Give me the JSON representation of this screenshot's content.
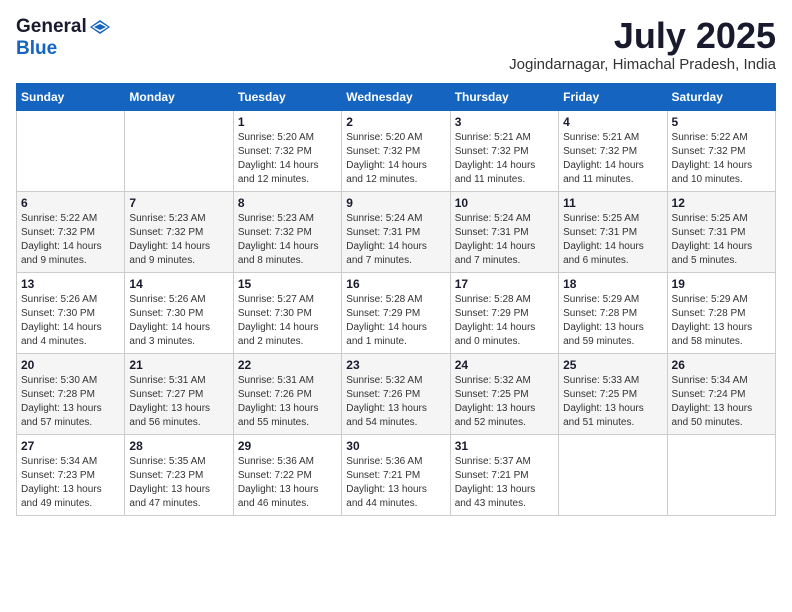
{
  "header": {
    "logo_general": "General",
    "logo_blue": "Blue",
    "month_year": "July 2025",
    "location": "Jogindarnagar, Himachal Pradesh, India"
  },
  "weekdays": [
    "Sunday",
    "Monday",
    "Tuesday",
    "Wednesday",
    "Thursday",
    "Friday",
    "Saturday"
  ],
  "weeks": [
    [
      {
        "day": "",
        "detail": ""
      },
      {
        "day": "",
        "detail": ""
      },
      {
        "day": "1",
        "detail": "Sunrise: 5:20 AM\nSunset: 7:32 PM\nDaylight: 14 hours\nand 12 minutes."
      },
      {
        "day": "2",
        "detail": "Sunrise: 5:20 AM\nSunset: 7:32 PM\nDaylight: 14 hours\nand 12 minutes."
      },
      {
        "day": "3",
        "detail": "Sunrise: 5:21 AM\nSunset: 7:32 PM\nDaylight: 14 hours\nand 11 minutes."
      },
      {
        "day": "4",
        "detail": "Sunrise: 5:21 AM\nSunset: 7:32 PM\nDaylight: 14 hours\nand 11 minutes."
      },
      {
        "day": "5",
        "detail": "Sunrise: 5:22 AM\nSunset: 7:32 PM\nDaylight: 14 hours\nand 10 minutes."
      }
    ],
    [
      {
        "day": "6",
        "detail": "Sunrise: 5:22 AM\nSunset: 7:32 PM\nDaylight: 14 hours\nand 9 minutes."
      },
      {
        "day": "7",
        "detail": "Sunrise: 5:23 AM\nSunset: 7:32 PM\nDaylight: 14 hours\nand 9 minutes."
      },
      {
        "day": "8",
        "detail": "Sunrise: 5:23 AM\nSunset: 7:32 PM\nDaylight: 14 hours\nand 8 minutes."
      },
      {
        "day": "9",
        "detail": "Sunrise: 5:24 AM\nSunset: 7:31 PM\nDaylight: 14 hours\nand 7 minutes."
      },
      {
        "day": "10",
        "detail": "Sunrise: 5:24 AM\nSunset: 7:31 PM\nDaylight: 14 hours\nand 7 minutes."
      },
      {
        "day": "11",
        "detail": "Sunrise: 5:25 AM\nSunset: 7:31 PM\nDaylight: 14 hours\nand 6 minutes."
      },
      {
        "day": "12",
        "detail": "Sunrise: 5:25 AM\nSunset: 7:31 PM\nDaylight: 14 hours\nand 5 minutes."
      }
    ],
    [
      {
        "day": "13",
        "detail": "Sunrise: 5:26 AM\nSunset: 7:30 PM\nDaylight: 14 hours\nand 4 minutes."
      },
      {
        "day": "14",
        "detail": "Sunrise: 5:26 AM\nSunset: 7:30 PM\nDaylight: 14 hours\nand 3 minutes."
      },
      {
        "day": "15",
        "detail": "Sunrise: 5:27 AM\nSunset: 7:30 PM\nDaylight: 14 hours\nand 2 minutes."
      },
      {
        "day": "16",
        "detail": "Sunrise: 5:28 AM\nSunset: 7:29 PM\nDaylight: 14 hours\nand 1 minute."
      },
      {
        "day": "17",
        "detail": "Sunrise: 5:28 AM\nSunset: 7:29 PM\nDaylight: 14 hours\nand 0 minutes."
      },
      {
        "day": "18",
        "detail": "Sunrise: 5:29 AM\nSunset: 7:28 PM\nDaylight: 13 hours\nand 59 minutes."
      },
      {
        "day": "19",
        "detail": "Sunrise: 5:29 AM\nSunset: 7:28 PM\nDaylight: 13 hours\nand 58 minutes."
      }
    ],
    [
      {
        "day": "20",
        "detail": "Sunrise: 5:30 AM\nSunset: 7:28 PM\nDaylight: 13 hours\nand 57 minutes."
      },
      {
        "day": "21",
        "detail": "Sunrise: 5:31 AM\nSunset: 7:27 PM\nDaylight: 13 hours\nand 56 minutes."
      },
      {
        "day": "22",
        "detail": "Sunrise: 5:31 AM\nSunset: 7:26 PM\nDaylight: 13 hours\nand 55 minutes."
      },
      {
        "day": "23",
        "detail": "Sunrise: 5:32 AM\nSunset: 7:26 PM\nDaylight: 13 hours\nand 54 minutes."
      },
      {
        "day": "24",
        "detail": "Sunrise: 5:32 AM\nSunset: 7:25 PM\nDaylight: 13 hours\nand 52 minutes."
      },
      {
        "day": "25",
        "detail": "Sunrise: 5:33 AM\nSunset: 7:25 PM\nDaylight: 13 hours\nand 51 minutes."
      },
      {
        "day": "26",
        "detail": "Sunrise: 5:34 AM\nSunset: 7:24 PM\nDaylight: 13 hours\nand 50 minutes."
      }
    ],
    [
      {
        "day": "27",
        "detail": "Sunrise: 5:34 AM\nSunset: 7:23 PM\nDaylight: 13 hours\nand 49 minutes."
      },
      {
        "day": "28",
        "detail": "Sunrise: 5:35 AM\nSunset: 7:23 PM\nDaylight: 13 hours\nand 47 minutes."
      },
      {
        "day": "29",
        "detail": "Sunrise: 5:36 AM\nSunset: 7:22 PM\nDaylight: 13 hours\nand 46 minutes."
      },
      {
        "day": "30",
        "detail": "Sunrise: 5:36 AM\nSunset: 7:21 PM\nDaylight: 13 hours\nand 44 minutes."
      },
      {
        "day": "31",
        "detail": "Sunrise: 5:37 AM\nSunset: 7:21 PM\nDaylight: 13 hours\nand 43 minutes."
      },
      {
        "day": "",
        "detail": ""
      },
      {
        "day": "",
        "detail": ""
      }
    ]
  ]
}
